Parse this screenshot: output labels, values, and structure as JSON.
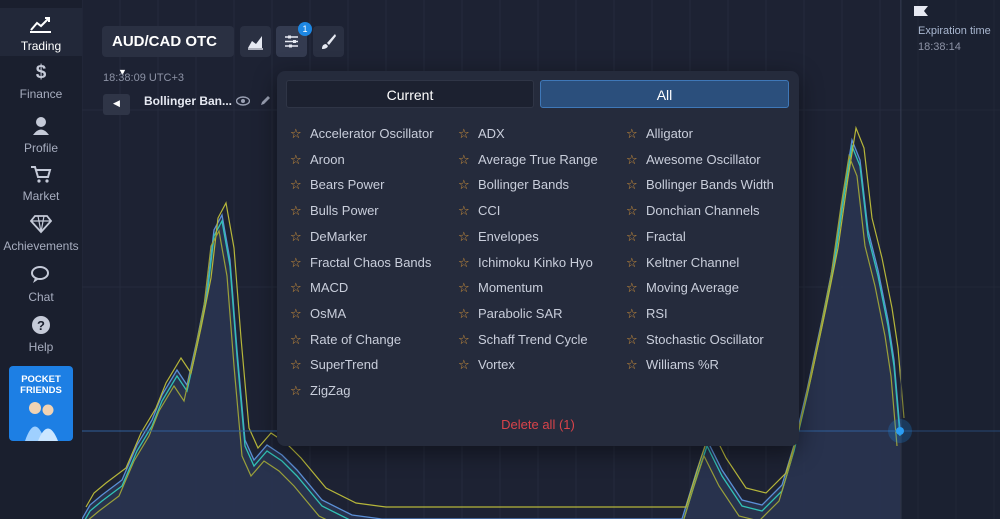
{
  "sidebar": {
    "items": [
      {
        "label": "Trading",
        "icon": "chart-line-icon"
      },
      {
        "label": "Finance",
        "icon": "dollar-icon"
      },
      {
        "label": "Profile",
        "icon": "user-icon"
      },
      {
        "label": "Market",
        "icon": "cart-icon"
      },
      {
        "label": "Achievements",
        "icon": "diamond-icon"
      },
      {
        "label": "Chat",
        "icon": "chat-icon"
      },
      {
        "label": "Help",
        "icon": "help-icon"
      }
    ],
    "promo": "POCKET FRIENDS"
  },
  "toolbar": {
    "pair": "AUD/CAD OTC",
    "indicators_badge": "1"
  },
  "chart": {
    "time": "18:38:09 UTC+3",
    "active_indicator": "Bollinger Ban...",
    "expiration_label": "Expiration time",
    "expiration_time": "18:38:14"
  },
  "panel": {
    "tabs": {
      "current": "Current",
      "all": "All"
    },
    "indicators": [
      "Accelerator Oscillator",
      "ADX",
      "Alligator",
      "Aroon",
      "Average True Range",
      "Awesome Oscillator",
      "Bears Power",
      "Bollinger Bands",
      "Bollinger Bands Width",
      "Bulls Power",
      "CCI",
      "Donchian Channels",
      "DeMarker",
      "Envelopes",
      "Fractal",
      "Fractal Chaos Bands",
      "Ichimoku Kinko Hyo",
      "Keltner Channel",
      "MACD",
      "Momentum",
      "Moving Average",
      "OsMA",
      "Parabolic SAR",
      "RSI",
      "Rate of Change",
      "Schaff Trend Cycle",
      "Stochastic Oscillator",
      "SuperTrend",
      "Vortex",
      "Williams %R",
      "ZigZag"
    ],
    "delete_all": "Delete all (1)"
  },
  "colors": {
    "accent": "#1d87e3",
    "star": "#d8963a",
    "delete": "#d9434a",
    "series_blue": "#5b8fd6",
    "series_teal": "#31c1b5",
    "series_yellow": "#b6b63a"
  }
}
